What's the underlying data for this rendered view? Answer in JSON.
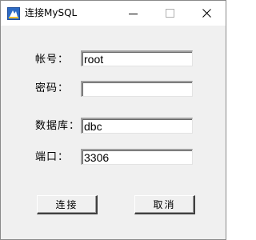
{
  "window": {
    "title": "连接MySQL"
  },
  "titlebar_icons": {
    "app": "mysql-app-icon",
    "minimize": "minimize-icon",
    "maximize": "maximize-icon",
    "close": "close-icon"
  },
  "form": {
    "account_label": "帐号：",
    "account_value": "root",
    "password_label": "密码：",
    "password_value": "",
    "database_label": "数据库：",
    "database_value": "dbc",
    "port_label": "端口：",
    "port_value": "3306"
  },
  "buttons": {
    "connect": "连接",
    "cancel": "取消"
  }
}
